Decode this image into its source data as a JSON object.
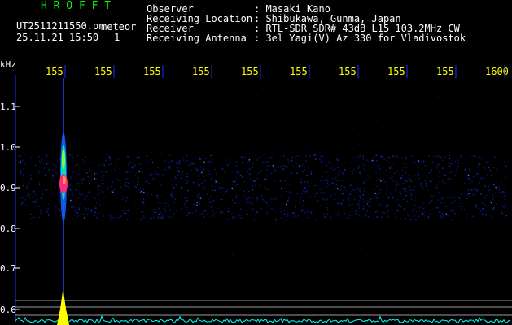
{
  "header": {
    "title": "H R O F F T",
    "file_name": "UT2511211550.pn",
    "file_tag": "meteor",
    "datetime": "25.11.21 15:50",
    "frame": "1"
  },
  "info": [
    {
      "label": "Observer",
      "value": ": Masaki Kano"
    },
    {
      "label": "Receiving Location",
      "value": ": Shibukawa, Gunma, Japan"
    },
    {
      "label": "Receiver",
      "value": ": RTL-SDR SDR# 43dB L15 103.2MHz CW"
    },
    {
      "label": "Receiving Antenna",
      "value": ": 3el Yagi(V) Az 330 for Vladivostok"
    }
  ],
  "colors": {
    "text_green": "#00ff00",
    "text_white": "#ffffff",
    "tick_yellow": "#ffff00",
    "axis_blue": "#2030ff",
    "noise_cyan": "#00ffff"
  },
  "spectrogram": {
    "y_unit": "kHz",
    "y_ticks": [
      "1.1",
      "1.0",
      "0.9",
      "0.8",
      "0.7",
      "0.6"
    ],
    "x_ticks": [
      "155",
      "155",
      "155",
      "155",
      "155",
      "155",
      "155",
      "155",
      "155",
      "1600"
    ]
  }
}
